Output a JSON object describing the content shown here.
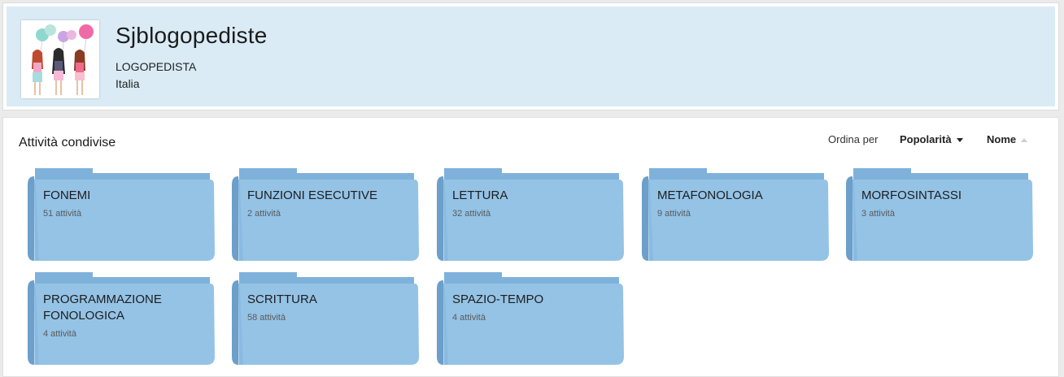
{
  "profile": {
    "name": "Sjblogopediste",
    "role": "LOGOPEDISTA",
    "country": "Italia"
  },
  "section": {
    "title": "Attività condivise",
    "sort_label": "Ordina per",
    "sort_popularity": "Popolarità",
    "sort_name": "Nome"
  },
  "folders": [
    {
      "title": "FONEMI",
      "count": "51 attività"
    },
    {
      "title": "FUNZIONI ESECUTIVE",
      "count": "2 attività"
    },
    {
      "title": "LETTURA",
      "count": "32 attività"
    },
    {
      "title": "METAFONOLOGIA",
      "count": "9 attività"
    },
    {
      "title": "MORFOSINTASSI",
      "count": "3 attività"
    },
    {
      "title": "PROGRAMMAZIONE FONOLOGICA",
      "count": "4 attività"
    },
    {
      "title": "SCRITTURA",
      "count": "58 attività"
    },
    {
      "title": "SPAZIO-TEMPO",
      "count": "4 attività"
    }
  ],
  "colors": {
    "header_bg": "#daebf6",
    "folder_face": "#94c3e6",
    "folder_back": "#7fb2db",
    "folder_spine": "#6c9fc9"
  }
}
